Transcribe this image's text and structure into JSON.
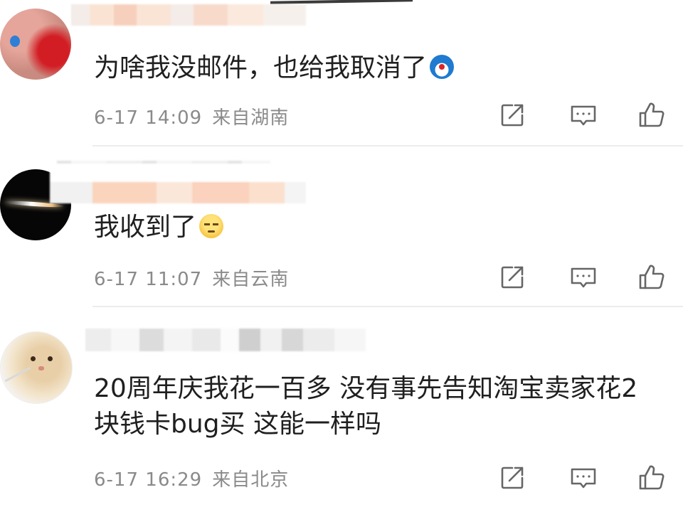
{
  "comments": [
    {
      "text": "为啥我没邮件，也给我取消了",
      "emoji": "doraemon-face-icon",
      "time": "6-17 14:09",
      "location": "来自湖南"
    },
    {
      "text": "我收到了",
      "emoji": "sleepy-face-icon",
      "time": "6-17 11:07",
      "location": "来自云南"
    },
    {
      "text": "20周年庆我花一百多 没有事先告知淘宝卖家花2\n块钱卡bug买 这能一样吗",
      "time": "6-17 16:29",
      "location": "来自北京"
    }
  ],
  "icons": {
    "share": "share-icon",
    "comment": "comment-icon",
    "like": "thumbs-up-icon"
  },
  "colors": {
    "text": "#1f1f1f",
    "meta": "#8a8a8a",
    "divider": "#ececec"
  }
}
